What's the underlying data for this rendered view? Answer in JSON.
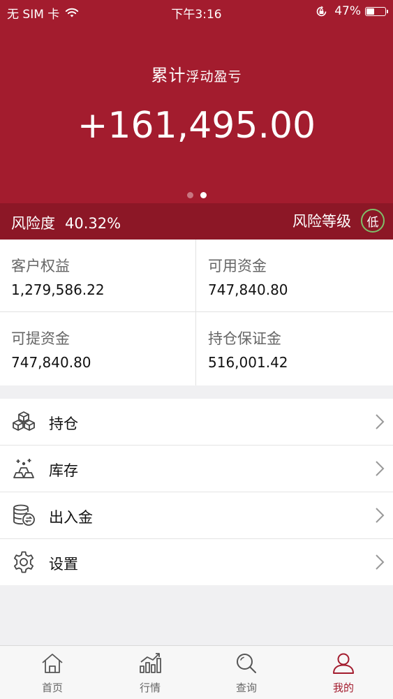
{
  "status_bar": {
    "carrier": "无 SIM 卡",
    "time": "下午3:16",
    "battery_percent": "47%",
    "battery_level": 0.47,
    "icons": [
      "wifi-icon",
      "orientation-lock-icon",
      "battery-icon"
    ]
  },
  "hero": {
    "title_main": "累计",
    "title_sub": "浮动盈亏",
    "value": "+161,495.00",
    "page_count": 2,
    "active_page": 2
  },
  "risk": {
    "label": "风险度",
    "percent": "40.32%",
    "level_label": "风险等级",
    "level_badge": "低",
    "badge_color": "#7fbf6a"
  },
  "account": {
    "customer_equity": {
      "label": "客户权益",
      "value": "1,279,586.22"
    },
    "available_funds": {
      "label": "可用资金",
      "value": "747,840.80"
    },
    "withdrawable_funds": {
      "label": "可提资金",
      "value": "747,840.80"
    },
    "position_margin": {
      "label": "持仓保证金",
      "value": "516,001.42"
    }
  },
  "menu": {
    "items": [
      {
        "label": "持仓",
        "icon": "boxes-icon"
      },
      {
        "label": "库存",
        "icon": "inventory-icon"
      },
      {
        "label": "出入金",
        "icon": "coins-icon"
      },
      {
        "label": "设置",
        "icon": "gear-icon"
      }
    ]
  },
  "tabbar": {
    "tabs": [
      {
        "label": "首页",
        "icon": "home-icon"
      },
      {
        "label": "行情",
        "icon": "chart-icon"
      },
      {
        "label": "查询",
        "icon": "search-icon"
      },
      {
        "label": "我的",
        "icon": "user-icon"
      }
    ],
    "active_index": 3
  },
  "colors": {
    "brand_red": "#a31c2e",
    "risk_bar": "#8c1726",
    "background": "#f0f0f2"
  }
}
